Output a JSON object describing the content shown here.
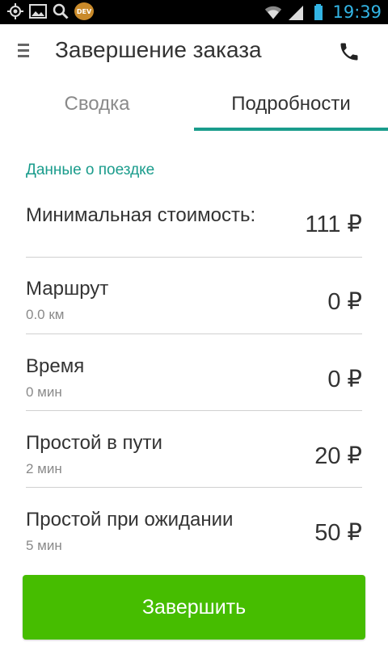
{
  "status_bar": {
    "time": "19:39",
    "dev_badge": "DEV",
    "icons": [
      "gps-icon",
      "image-icon",
      "search-icon",
      "dev-badge",
      "wifi-icon",
      "signal-icon",
      "battery-icon"
    ]
  },
  "toolbar": {
    "title": "Завершение заказа",
    "menu_icon": "menu-icon",
    "phone_icon": "phone-icon"
  },
  "tabs": [
    {
      "label": "Сводка",
      "selected": false
    },
    {
      "label": "Подробности",
      "selected": true
    }
  ],
  "details": {
    "section_title": "Данные о поездке",
    "rows": [
      {
        "label": "Минимальная стоимость:",
        "sub": "",
        "amount": "111 ₽"
      },
      {
        "label": "Маршрут",
        "sub": "0.0 км",
        "amount": "0 ₽"
      },
      {
        "label": "Время",
        "sub": "0 мин",
        "amount": "0 ₽"
      },
      {
        "label": "Простой в пути",
        "sub": "2 мин",
        "amount": "20 ₽"
      },
      {
        "label": "Простой при ожидании",
        "sub": "5 мин",
        "amount": "50 ₽"
      }
    ]
  },
  "actions": {
    "finish_label": "Завершить"
  },
  "colors": {
    "accent": "#1a9c8c",
    "button": "#46bd00",
    "status_time": "#33b5e5"
  }
}
